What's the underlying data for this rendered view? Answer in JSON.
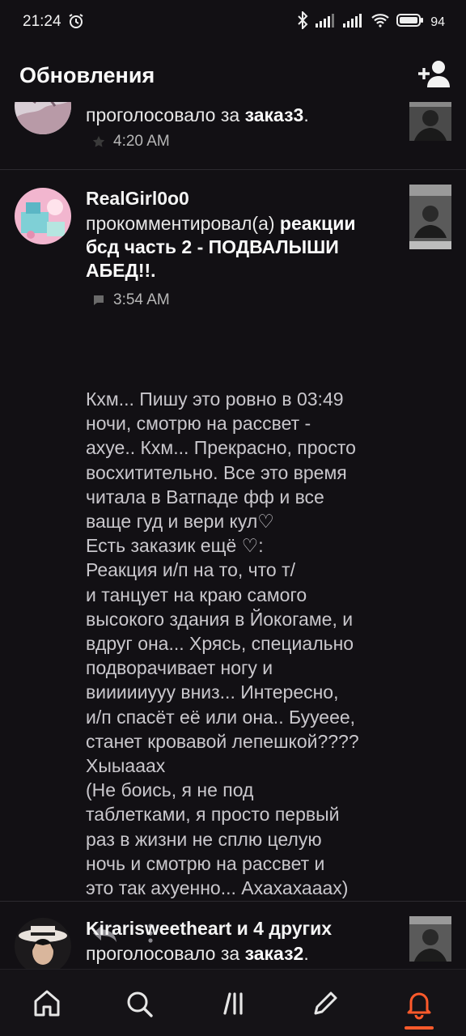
{
  "status_bar": {
    "time": "21:24",
    "battery": "94"
  },
  "app_bar": {
    "title": "Обновления"
  },
  "feed": {
    "items": [
      {
        "name": "",
        "action": "проголосовало за",
        "target": "заказ3",
        "suffix": ".",
        "time": "4:20 AM",
        "meta_icon": "star-icon"
      },
      {
        "name": "RealGirl0o0",
        "action": "прокомментировал(а)",
        "target": "реакции бсд часть 2 - ПОДВАЛЫШИ АБЕД!!",
        "suffix": ".",
        "line1_rest": "реакции",
        "line2": "бсд часть 2 - ПОДВАЛЫШИ",
        "line3": "АБЕД!!.",
        "time": "3:54 AM",
        "meta_icon": "comment-icon",
        "comment": "Кхм... Пишу это ровно в 03:49\nночи, смотрю на рассвет -\nахуе.. Кхм... Прекрасно, просто\nвосхитительно. Все это время\nчитала в Ватпаде фф и все\nваще гуд и вери кул♡\nЕсть заказик ещё ♡:\nРеакция и/п на то, что т/\nи танцует на краю самого\nвысокого здания в Йокогаме, и\nвдруг она... Хрясь, специально\nподворачивает ногу и\nвиииииууу вниз... Интересно,\nи/п спасёт её или она.. Бууеее,\nстанет кровавой лепешкой????\nХыыааах\n(Не боись, я не под\nтаблетками, я просто первый\nраз в жизни не сплю целую\nночь и смотрю на рассвет и\nэто так ахуенно... Ахахахааах)"
      },
      {
        "name": "Kirarisweetheart и 4 других",
        "action": "проголосовало за",
        "target": "заказ2",
        "suffix": "."
      }
    ]
  },
  "colors": {
    "accent": "#ff5a2b",
    "background": "#121014"
  }
}
